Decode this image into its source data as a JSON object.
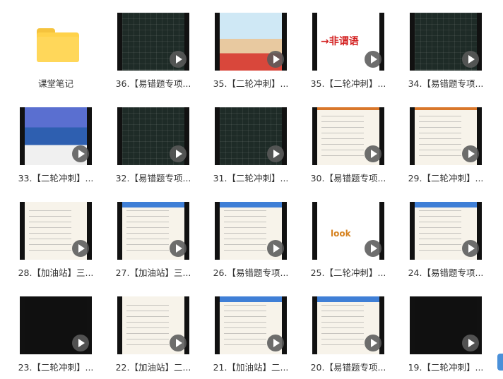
{
  "folder": {
    "name": "课堂笔记",
    "icon": "folder-icon"
  },
  "videos": [
    {
      "title": "36.【易错题专项...",
      "style": "chalk"
    },
    {
      "title": "35.【二轮冲刺】...",
      "style": "slide"
    },
    {
      "title": "35.【二轮冲刺】...",
      "style": "slide",
      "overlay": "→非谓语"
    },
    {
      "title": "34.【易错题专项...",
      "style": "chalk"
    },
    {
      "title": "33.【二轮冲刺】...",
      "style": "slide"
    },
    {
      "title": "32.【易错题专项...",
      "style": "chalk"
    },
    {
      "title": "31.【二轮冲刺】...",
      "style": "chalk"
    },
    {
      "title": "30.【易错题专项...",
      "style": "slide"
    },
    {
      "title": "29.【二轮冲刺】...",
      "style": "slide"
    },
    {
      "title": "28.【加油站】三...",
      "style": "slide"
    },
    {
      "title": "27.【加油站】三...",
      "style": "slide"
    },
    {
      "title": "26.【易错题专项...",
      "style": "slide"
    },
    {
      "title": "25.【二轮冲刺】...",
      "style": "slide",
      "overlay": "look"
    },
    {
      "title": "24.【易错题专项...",
      "style": "slide"
    },
    {
      "title": "23.【二轮冲刺】...",
      "style": "dark"
    },
    {
      "title": "22.【加油站】二...",
      "style": "slide"
    },
    {
      "title": "21.【加油站】二...",
      "style": "slide"
    },
    {
      "title": "20.【易错题专项...",
      "style": "slide"
    },
    {
      "title": "19.【二轮冲刺】...",
      "style": "dark"
    }
  ]
}
